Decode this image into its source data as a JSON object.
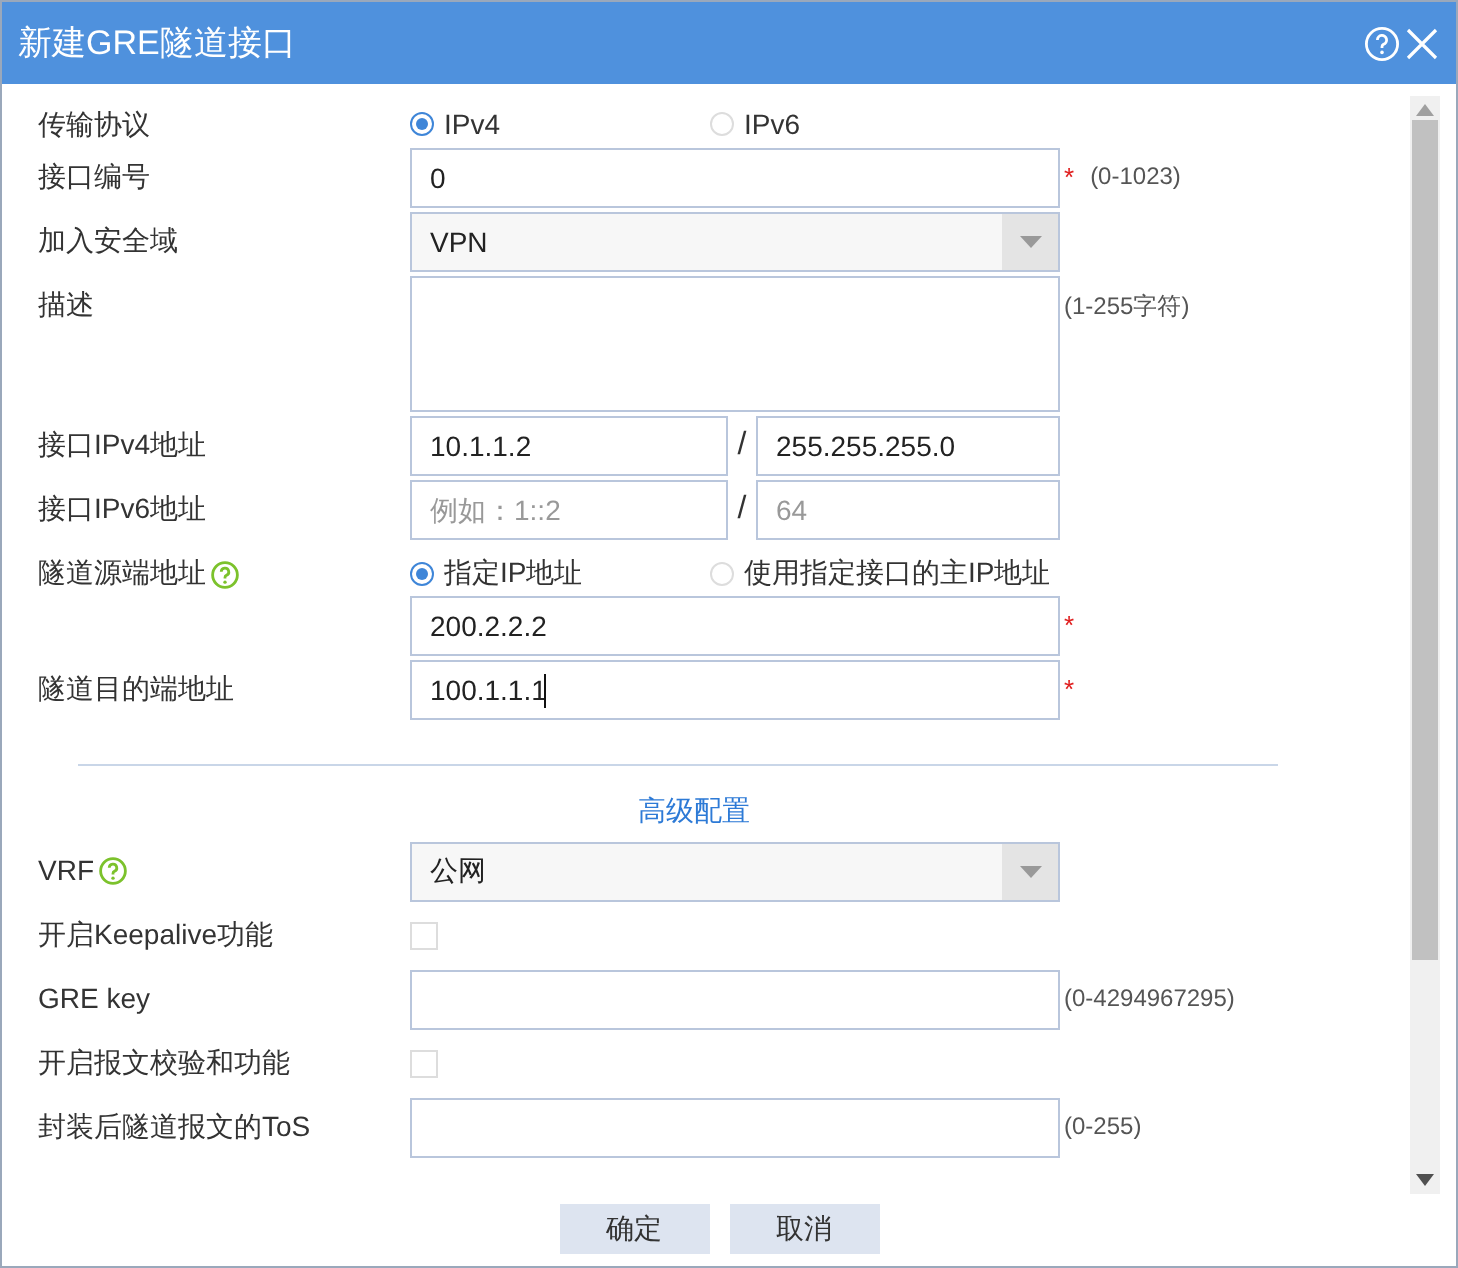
{
  "window": {
    "title": "新建GRE隧道接口"
  },
  "fields": [
    {
      "kind": "radio",
      "label": "传输协议",
      "options": [
        {
          "label": "IPv4",
          "selected": true
        },
        {
          "label": "IPv6",
          "selected": false
        }
      ]
    },
    {
      "kind": "text",
      "label": "接口编号",
      "value": "0",
      "required_mark": "*",
      "hint": "(0-1023)"
    },
    {
      "kind": "select",
      "label": "加入安全域",
      "value": "VPN"
    },
    {
      "kind": "textarea",
      "label": "描述",
      "hint": "(1-255字符)"
    },
    {
      "kind": "pair",
      "label": "接口IPv4地址",
      "separator": "/",
      "first": {
        "value": "10.1.1.2"
      },
      "second": {
        "value": "255.255.255.0"
      }
    },
    {
      "kind": "pair",
      "label": "接口IPv6地址",
      "separator": "/",
      "first": {
        "placeholder": "例如：1::2"
      },
      "second": {
        "placeholder": "64"
      }
    },
    {
      "kind": "radio",
      "label": "隧道源端地址",
      "help": true,
      "options": [
        {
          "label": "指定IP地址",
          "selected": true
        },
        {
          "label": "使用指定接口的主IP地址",
          "selected": false
        }
      ]
    },
    {
      "kind": "text",
      "value": "200.2.2.2",
      "required_mark": "*"
    },
    {
      "kind": "text",
      "label": "隧道目的端地址",
      "value": "100.1.1.1",
      "required_mark": "*",
      "focused": true
    },
    {
      "kind": "section",
      "label": "高级配置"
    },
    {
      "kind": "select",
      "label": "VRF",
      "help": true,
      "value": "公网"
    },
    {
      "kind": "check",
      "label": "开启Keepalive功能",
      "checked": false
    },
    {
      "kind": "text",
      "label": "GRE key",
      "hint": "(0-4294967295)"
    },
    {
      "kind": "check",
      "label": "开启报文校验和功能",
      "checked": false
    },
    {
      "kind": "text",
      "label": "封装后隧道报文的ToS",
      "hint": "(0-255)"
    }
  ],
  "buttons": [
    "确定",
    "取消"
  ]
}
